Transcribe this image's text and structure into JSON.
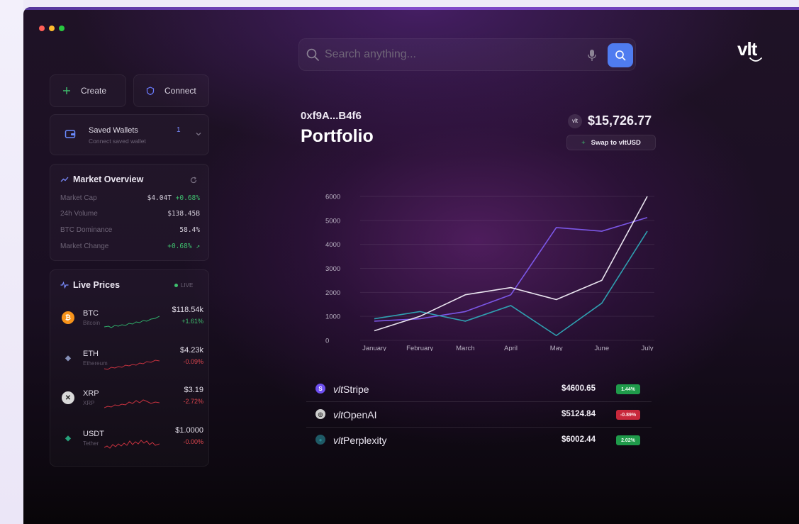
{
  "search": {
    "placeholder": "Search anything..."
  },
  "logo": {
    "text": "vlt"
  },
  "actions": {
    "create_label": "Create",
    "connect_label": "Connect"
  },
  "wallets": {
    "title": "Saved Wallets",
    "count": "1",
    "subtitle": "Connect saved wallet"
  },
  "market": {
    "title": "Market Overview",
    "rows": [
      {
        "label": "Market Cap",
        "value": "$4.04T",
        "change": "+0.68%"
      },
      {
        "label": "24h Volume",
        "value": "$138.45B",
        "change": ""
      },
      {
        "label": "BTC Dominance",
        "value": "58.4%",
        "change": ""
      },
      {
        "label": "Market Change",
        "value": "",
        "change": "+0.68% ↗"
      }
    ]
  },
  "live_prices": {
    "title": "Live Prices",
    "badge": "LIVE",
    "coins": [
      {
        "symbol": "BTC",
        "name": "Bitcoin",
        "price": "$118.54k",
        "change": "+1.61%",
        "trend": "up",
        "color": "#f7931a",
        "glyph": "₿"
      },
      {
        "symbol": "ETH",
        "name": "Ethereum",
        "price": "$4.23k",
        "change": "-0.09%",
        "trend": "down",
        "color": "#6f7ba0",
        "glyph": "◆"
      },
      {
        "symbol": "XRP",
        "name": "XRP",
        "price": "$3.19",
        "change": "-2.72%",
        "trend": "down",
        "color": "#d9d9d9",
        "glyph": "✕"
      },
      {
        "symbol": "USDT",
        "name": "Tether",
        "price": "$1.0000",
        "change": "-0.00%",
        "trend": "down",
        "color": "#26a17b",
        "glyph": "◆"
      }
    ]
  },
  "portfolio": {
    "address": "0xf9A...B4f6",
    "title": "Portfolio",
    "balance_chip": "vlt",
    "balance": "$15,726.77",
    "swap_label": "Swap to vltUSD"
  },
  "chart_data": {
    "type": "line",
    "categories": [
      "January",
      "February",
      "March",
      "April",
      "May",
      "June",
      "July"
    ],
    "yticks": [
      0,
      1000,
      2000,
      3000,
      4000,
      5000,
      6000
    ],
    "ylim": [
      0,
      6000
    ],
    "grid": true,
    "series": [
      {
        "color": "#7b57e6",
        "values": [
          800,
          900,
          1200,
          1900,
          4700,
          4550,
          5120
        ]
      },
      {
        "color": "#2f9fb0",
        "values": [
          900,
          1200,
          800,
          1450,
          200,
          1550,
          4550
        ]
      },
      {
        "color": "#e9e4ef",
        "values": [
          400,
          1000,
          1900,
          2200,
          1700,
          2500,
          6000
        ]
      }
    ]
  },
  "holdings": [
    {
      "prefix": "vlt",
      "name": "Stripe",
      "price": "$4600.65",
      "change": "1.44%",
      "positive": true,
      "icon_color": "#6e4ff0",
      "icon_glyph": "S"
    },
    {
      "prefix": "vlt",
      "name": "OpenAI",
      "price": "$5124.84",
      "change": "-0.89%",
      "positive": false,
      "icon_color": "#cfcfcf",
      "icon_glyph": "◎"
    },
    {
      "prefix": "vlt",
      "name": "Perplexity",
      "price": "$6002.44",
      "change": "2.02%",
      "positive": true,
      "icon_color": "#1f5a66",
      "icon_glyph": "●"
    }
  ]
}
